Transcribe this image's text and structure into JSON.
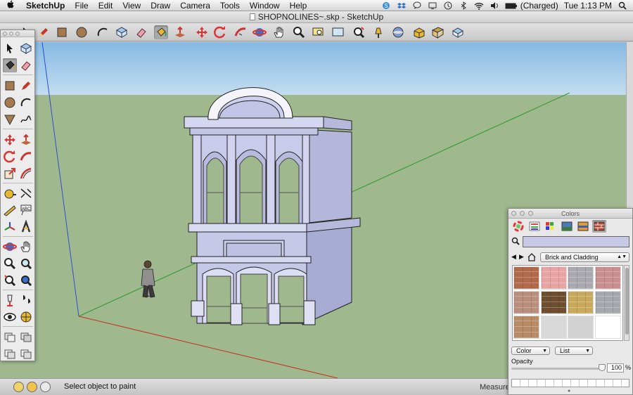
{
  "menubar": {
    "apple": "",
    "menus": [
      "SketchUp",
      "File",
      "Edit",
      "View",
      "Draw",
      "Camera",
      "Tools",
      "Window",
      "Help"
    ],
    "battery": "(Charged)",
    "clock": "Tue 1:13 PM",
    "status_icons": [
      "skype-icon",
      "dropbox-icon",
      "ichat-icon",
      "display-icon",
      "timemachine-icon",
      "bluetooth-icon",
      "wifi-icon",
      "volume-icon",
      "battery-icon",
      "spotlight-icon"
    ]
  },
  "window": {
    "title": "SHOPNOLINES~.skp - SketchUp"
  },
  "toolbar": {
    "tools": [
      "select",
      "eraser",
      "pencil",
      "rectangle",
      "circle",
      "arc",
      "make-component",
      "paint-bucket",
      "push-pull",
      "move",
      "rotate",
      "follow-me",
      "orbit",
      "pan",
      "zoom",
      "zoom-window",
      "previous",
      "zoom-extents",
      "position-camera",
      "look-around",
      "walk",
      "section-plane",
      "tape-measure",
      "dimension",
      "protractor"
    ],
    "active_tool": "paint-bucket"
  },
  "palette": {
    "tools": [
      "select",
      "make-component",
      "paint-bucket",
      "eraser",
      "rectangle",
      "line",
      "circle",
      "arc",
      "polygon",
      "freehand",
      "move",
      "push-pull",
      "rotate",
      "follow-me",
      "scale",
      "offset",
      "tape-measure",
      "dimension",
      "protractor",
      "text",
      "axes",
      "3d-text",
      "orbit",
      "pan",
      "zoom",
      "zoom-window",
      "zoom-extents",
      "previous",
      "position-camera",
      "look-around",
      "walk",
      "section-plane",
      "display-section",
      "display-cuts"
    ],
    "active_tool": "paint-bucket"
  },
  "status": {
    "text": "Select object to paint",
    "measurements_label": "Measure"
  },
  "colors_panel": {
    "title": "Colors",
    "current_color": "#c8c9e6",
    "library": "Brick and Cladding",
    "swatches": [
      "#b06a4a",
      "#e8a3a3",
      "#aaa9b0",
      "#c98f8f",
      "#b98e7c",
      "#6f4d2f",
      "#c8a85b",
      "#a6a8ad",
      "#b98a66",
      "#d9d9d9",
      "#d2d2d2",
      "#ffffff"
    ],
    "view_popup": "Color",
    "sort_popup": "List",
    "opacity_label": "Opacity",
    "opacity_value": "100",
    "opacity_unit": "%"
  },
  "colors": {
    "sky": "#9fc7e6",
    "ground": "#9fb88d",
    "building": "#c7c9ea",
    "active_tool_bg": "#a8a8a8"
  }
}
